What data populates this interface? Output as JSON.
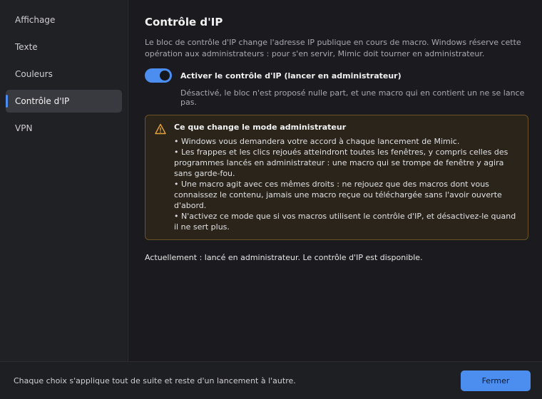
{
  "sidebar": {
    "items": [
      {
        "label": "Affichage"
      },
      {
        "label": "Texte"
      },
      {
        "label": "Couleurs"
      },
      {
        "label": "Contrôle d'IP"
      },
      {
        "label": "VPN"
      }
    ],
    "active_index": 3
  },
  "main": {
    "title": "Contrôle d'IP",
    "description": "Le bloc de contrôle d'IP change l'adresse IP publique en cours de macro. Windows réserve cette opération aux administrateurs : pour s'en servir, Mimic doit tourner en administrateur.",
    "toggle": {
      "label": "Activer le contrôle d'IP (lancer en administrateur)",
      "enabled": true,
      "hint": "Désactivé, le bloc n'est proposé nulle part, et une macro qui en contient un ne se lance pas."
    },
    "warning": {
      "icon": "warning-icon",
      "title": "Ce que change le mode administrateur",
      "lines": [
        "• Windows vous demandera votre accord à chaque lancement de Mimic.",
        "• Les frappes et les clics rejoués atteindront toutes les fenêtres, y compris celles des programmes lancés en administrateur : une macro qui se trompe de fenêtre y agira sans garde-fou.",
        "• Une macro agit avec ces mêmes droits : ne rejouez que des macros dont vous connaissez le contenu, jamais une macro reçue ou téléchargée sans l'avoir ouverte d'abord.",
        "• N'activez ce mode que si vos macros utilisent le contrôle d'IP, et désactivez-le quand il ne sert plus."
      ]
    },
    "status": "Actuellement : lancé en administrateur. Le contrôle d'IP est disponible."
  },
  "footer": {
    "note": "Chaque choix s'applique tout de suite et reste d'un lancement à l'autre.",
    "close_label": "Fermer"
  },
  "colors": {
    "accent": "#4c8df0",
    "warning_border": "#6b5323",
    "warning_icon": "#e5a33a"
  }
}
